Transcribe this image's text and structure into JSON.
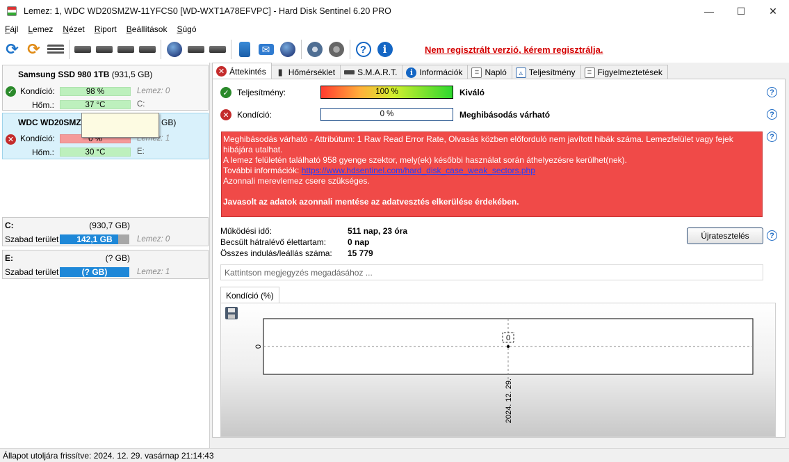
{
  "window": {
    "title": "Lemez: 1, WDC WD20SMZW-11YFCS0 [WD-WXT1A78EFVPC]  -  Hard Disk Sentinel 6.20 PRO",
    "minimize": "—",
    "maximize": "☐",
    "close": "✕"
  },
  "menu": [
    {
      "label": "Fájl",
      "u": "F",
      "rest": "ájl"
    },
    {
      "label": "Lemez",
      "u": "L",
      "rest": "emez"
    },
    {
      "label": "Nézet",
      "u": "N",
      "rest": "ézet"
    },
    {
      "label": "Riport",
      "u": "R",
      "rest": "iport"
    },
    {
      "label": "Beállítások",
      "u": "B",
      "rest": "eállítások"
    },
    {
      "label": "Súgó",
      "u": "S",
      "rest": "úgó"
    }
  ],
  "toolbar": {
    "unregistered_text": "Nem regisztrált verzió, kérem regisztrálja.",
    "icons": [
      "refresh-icon",
      "refresh-all-icon",
      "list-icon",
      "disk-icon",
      "disk-schedule-icon",
      "disk-check-icon",
      "disk-search-icon",
      "globe-disk-icon",
      "disk-tools-icon",
      "disk-export-icon",
      "report-icon",
      "mail-icon",
      "network-icon",
      "gear-icon",
      "speaker-icon",
      "help-icon",
      "info-icon"
    ]
  },
  "disks": [
    {
      "name": "Samsung SSD 980 1TB",
      "size": "(931,5 GB)",
      "condition_label": "Kondíció:",
      "condition_value": "98 %",
      "condition_pct": 98,
      "disk_label": "Lemez: 0",
      "temp_label": "Hőm.:",
      "temp_value": "37 °C",
      "letters": "C:"
    },
    {
      "name": "WDC WD20SMZ",
      "size": "GB)",
      "condition_label": "Kondíció:",
      "condition_value": "0 %",
      "condition_pct": 0,
      "disk_label": "Lemez: 1",
      "temp_label": "Hőm.:",
      "temp_value": "30 °C",
      "letters": "E:"
    }
  ],
  "volumes": [
    {
      "letter": "C:",
      "size": "(930,7 GB)",
      "free_label": "Szabad terület",
      "free_value": "142,1 GB",
      "free_pct": 84,
      "disk_label": "Lemez: 0"
    },
    {
      "letter": "E:",
      "size": "(? GB)",
      "free_label": "Szabad terület",
      "free_value": "(? GB)",
      "free_pct": 100,
      "disk_label": "Lemez: 1"
    }
  ],
  "tabs": [
    {
      "label": "Áttekintés",
      "icon": "x-icon"
    },
    {
      "label": "Hőmérséklet",
      "icon": "thermometer-icon"
    },
    {
      "label": "S.M.A.R.T.",
      "icon": "smart-icon"
    },
    {
      "label": "Információk",
      "icon": "info-icon"
    },
    {
      "label": "Napló",
      "icon": "log-icon"
    },
    {
      "label": "Teljesítmény",
      "icon": "chart-icon"
    },
    {
      "label": "Figyelmeztetések",
      "icon": "warning-icon"
    }
  ],
  "overview": {
    "performance_label": "Teljesítmény:",
    "performance_value": "100 %",
    "performance_verdict": "Kiváló",
    "condition_label": "Kondíció:",
    "condition_value": "0 %",
    "condition_verdict": "Meghibásodás várható",
    "alert": {
      "line1": "Meghibásodás várható - Attribútum: 1 Raw Read Error Rate, Olvasás közben előforduló nem javított hibák száma. Lemezfelület vagy fejek hibájára utalhat.",
      "line2": "A lemez felületén található 958 gyenge szektor, mely(ek) későbbi használat során áthelyezésre kerülhet(nek).",
      "line3_prefix": "További információk: ",
      "line3_link": "https://www.hdsentinel.com/hard_disk_case_weak_sectors.php",
      "line4": "Azonnali merevlemez csere szükséges.",
      "line5": "Javasolt az adatok azonnali mentése az adatvesztés elkerülése érdekében."
    },
    "uptime_label": "Működési idő:",
    "uptime_value": "511 nap, 23 óra",
    "remaining_label": "Becsült hátralévő élettartam:",
    "remaining_value": "0 nap",
    "startstop_label": "Összes indulás/leállás száma:",
    "startstop_value": "15 779",
    "retest_button": "Újratesztelés",
    "note_placeholder": "Kattintson megjegyzés megadásához ...",
    "chart_tab": "Kondíció  (%)"
  },
  "chart_data": {
    "type": "line",
    "x": [
      "2024. 12. 29."
    ],
    "series": [
      {
        "values": [
          0
        ]
      }
    ],
    "ytick_labels": [
      "0"
    ],
    "data_labels": [
      "0"
    ]
  },
  "statusbar": {
    "text": "Állapot utoljára frissítve: 2024. 12. 29. vasárnap 21:14:43"
  }
}
